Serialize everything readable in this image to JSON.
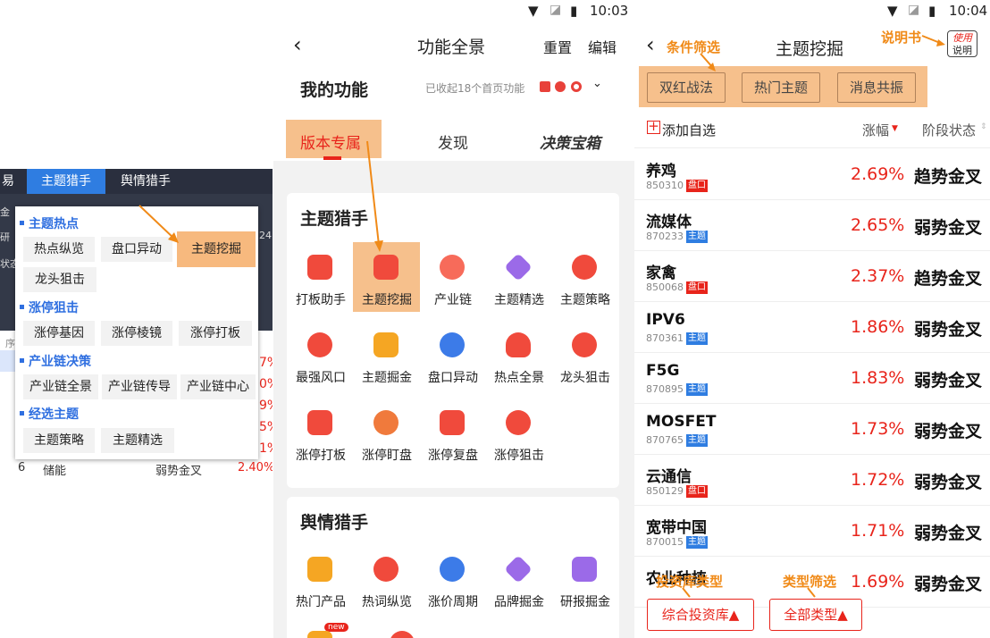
{
  "colors": {
    "accent_blue": "#2f7de1",
    "orange": "#f08a18",
    "red": "#e8241b",
    "dark_bar": "#2a2f3e"
  },
  "panel1": {
    "topbar": {
      "tab_trade": "易",
      "tab_theme": "主题猎手",
      "tab_sentiment": "舆情猎手"
    },
    "bg_texts": {
      "a": "金",
      "b": "研",
      "c": "状态",
      "d": "序",
      "e": "24"
    },
    "bg_values": [
      "7%",
      "0%",
      "9%",
      "5%",
      "1%"
    ],
    "bg_last_row": {
      "idx": "6",
      "name": "储能",
      "status": "弱势金叉",
      "pct": "2.40%"
    },
    "menu": {
      "sections": [
        {
          "title": "主题热点",
          "items": [
            "热点纵览",
            "盘口异动",
            "主题挖掘",
            "龙头狙击"
          ]
        },
        {
          "title": "涨停狙击",
          "items": [
            "涨停基因",
            "涨停棱镜",
            "涨停打板"
          ]
        },
        {
          "title": "产业链决策",
          "items": [
            "产业链全景",
            "产业链传导",
            "产业链中心"
          ]
        },
        {
          "title": "经选主题",
          "items": [
            "主题策略",
            "主题精选"
          ]
        }
      ]
    }
  },
  "panel2": {
    "status_time": "10:03",
    "title": "功能全景",
    "reset": "重置",
    "edit": "编辑",
    "my_functions": "我的功能",
    "collected": "已收起18个首页功能",
    "tabs": [
      "版本专属",
      "发现",
      "决策宝箱"
    ],
    "card1": {
      "title": "主题猎手",
      "items": [
        "打板助手",
        "主题挖掘",
        "产业链",
        "主题精选",
        "主题策略",
        "最强风口",
        "主题掘金",
        "盘口异动",
        "热点全景",
        "龙头狙击",
        "涨停打板",
        "涨停盯盘",
        "涨停复盘",
        "涨停狙击"
      ]
    },
    "card2": {
      "title": "舆情猎手",
      "items": [
        "热门产品",
        "热词纵览",
        "涨价周期",
        "品牌掘金",
        "研报掘金"
      ],
      "new_badge": "new"
    }
  },
  "panel3": {
    "status_time": "10:04",
    "title": "主题挖掘",
    "annotations": {
      "filter": "条件筛选",
      "manual": "说明书",
      "library": "投资库类型",
      "type": "类型筛选"
    },
    "manual_icon": {
      "line1": "使用",
      "line2": "说明"
    },
    "chips": [
      "双红战法",
      "热门主题",
      "消息共振"
    ],
    "add_watch": "添加自选",
    "col_change": "涨幅",
    "col_stage": "阶段状态",
    "rows": [
      {
        "name": "养鸡",
        "code": "850310",
        "tag": "盘口",
        "pct": "2.69%",
        "status": "趋势金叉"
      },
      {
        "name": "流媒体",
        "code": "870233",
        "tag": "主题",
        "pct": "2.65%",
        "status": "弱势金叉"
      },
      {
        "name": "家禽",
        "code": "850068",
        "tag": "盘口",
        "pct": "2.37%",
        "status": "趋势金叉"
      },
      {
        "name": "IPV6",
        "code": "870361",
        "tag": "主题",
        "pct": "1.86%",
        "status": "弱势金叉"
      },
      {
        "name": "F5G",
        "code": "870895",
        "tag": "主题",
        "pct": "1.83%",
        "status": "弱势金叉"
      },
      {
        "name": "MOSFET",
        "code": "870765",
        "tag": "主题",
        "pct": "1.73%",
        "status": "弱势金叉"
      },
      {
        "name": "云通信",
        "code": "850129",
        "tag": "盘口",
        "pct": "1.72%",
        "status": "弱势金叉"
      },
      {
        "name": "宽带中国",
        "code": "870015",
        "tag": "主题",
        "pct": "1.71%",
        "status": "弱势金叉"
      },
      {
        "name": "农业种植",
        "code": "",
        "tag": "",
        "pct": "1.69%",
        "status": "弱势金叉"
      }
    ],
    "filter_library": "综合投资库▲",
    "filter_type": "全部类型▲"
  }
}
